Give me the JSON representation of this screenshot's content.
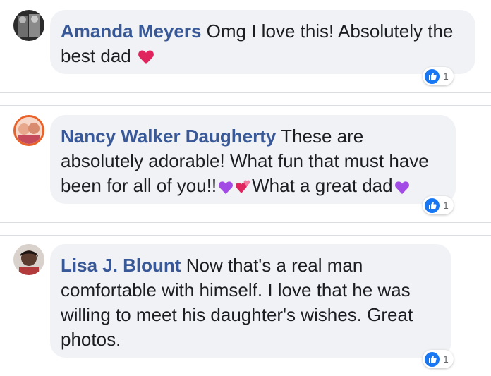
{
  "comments": [
    {
      "author": "Amanda Meyers",
      "text": "Omg I love this! Absolutely the best dad",
      "emojis": [
        "red-heart"
      ],
      "reaction_icon": "like-icon",
      "reaction_count": "1",
      "colors": {
        "avatar": "#3a3a3a"
      }
    },
    {
      "author": "Nancy Walker Daugherty",
      "text": "These are absolutely adorable! What fun that must have been for all of you!!",
      "emojis_mid": [
        "purple-heart",
        "revolving-hearts"
      ],
      "text_after": "What a great dad",
      "emojis_end": [
        "purple-heart"
      ],
      "reaction_icon": "like-icon",
      "reaction_count": "1",
      "colors": {
        "avatar_ring": "#e8622a"
      }
    },
    {
      "author": "Lisa J. Blount",
      "text": "Now that's a real man comfortable with himself. I love that he was willing to meet his daughter's wishes. Great photos.",
      "reaction_icon": "like-icon",
      "reaction_count": "1",
      "colors": {
        "avatar": "#5a3b2e"
      }
    }
  ],
  "colors": {
    "author_link": "#385898",
    "bubble_bg": "#f0f2f5",
    "text": "#1c1e21",
    "like_blue": "#1877f2",
    "divider": "#dadde1"
  }
}
